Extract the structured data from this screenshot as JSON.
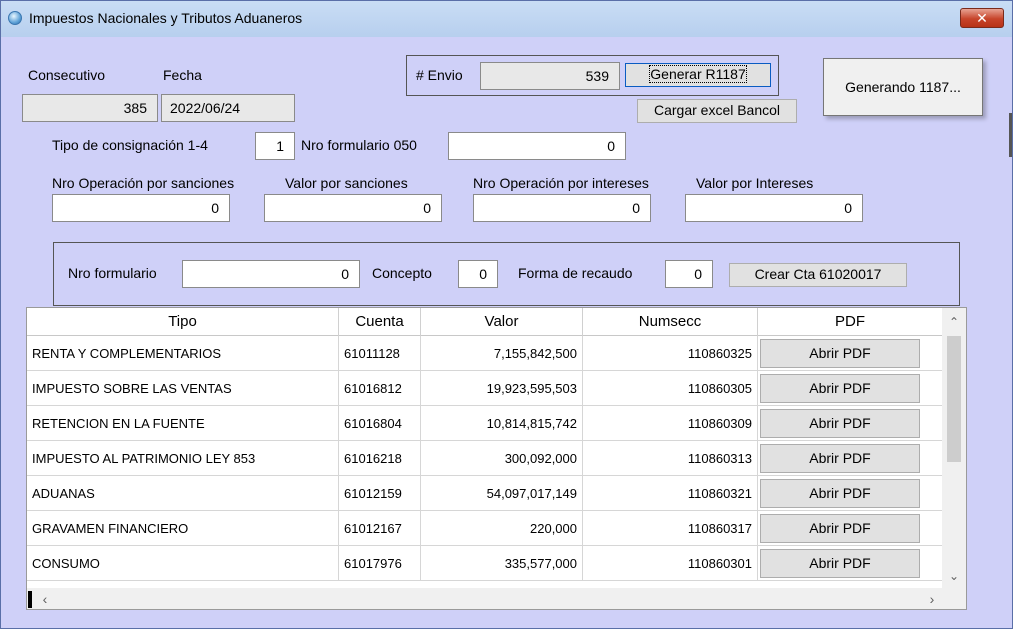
{
  "window": {
    "title": "Impuestos Nacionales y Tributos Aduaneros",
    "close_symbol": "✕"
  },
  "header": {
    "consecutivo_label": "Consecutivo",
    "consecutivo_value": "385",
    "fecha_label": "Fecha",
    "fecha_value": "2022/06/24"
  },
  "envio": {
    "label": "# Envio",
    "value": "539",
    "generar_button": "Generar R1187",
    "cargar_button": "Cargar excel Bancol"
  },
  "popup": {
    "text": "Generando 1187..."
  },
  "form": {
    "tipo_consignacion_label": "Tipo de consignación 1-4",
    "tipo_consignacion_value": "1",
    "nro_formulario_050_label": "Nro formulario 050",
    "nro_formulario_050_value": "0",
    "nro_op_sanciones_label": "Nro Operación por sanciones",
    "nro_op_sanciones_value": "0",
    "valor_sanciones_label": "Valor por sanciones",
    "valor_sanciones_value": "0",
    "nro_op_intereses_label": "Nro Operación por intereses",
    "nro_op_intereses_value": "0",
    "valor_intereses_label": "Valor por Intereses",
    "valor_intereses_value": "0"
  },
  "frame": {
    "nro_formulario_label": "Nro formulario",
    "nro_formulario_value": "0",
    "concepto_label": "Concepto",
    "concepto_value": "0",
    "forma_recaudo_label": "Forma de recaudo",
    "forma_recaudo_value": "0",
    "crear_button": "Crear Cta 61020017"
  },
  "grid": {
    "columns": [
      "Tipo",
      "Cuenta",
      "Valor",
      "Numsecc",
      "PDF"
    ],
    "rows": [
      {
        "tipo": "RENTA Y COMPLEMENTARIOS",
        "cuenta": "61011128",
        "valor": "7,155,842,500",
        "numsecc": "110860325",
        "pdf": "Abrir PDF"
      },
      {
        "tipo": "IMPUESTO SOBRE LAS VENTAS",
        "cuenta": "61016812",
        "valor": "19,923,595,503",
        "numsecc": "110860305",
        "pdf": "Abrir PDF"
      },
      {
        "tipo": "RETENCION EN LA FUENTE",
        "cuenta": "61016804",
        "valor": "10,814,815,742",
        "numsecc": "110860309",
        "pdf": "Abrir PDF"
      },
      {
        "tipo": "IMPUESTO AL PATRIMONIO LEY 853",
        "cuenta": "61016218",
        "valor": "300,092,000",
        "numsecc": "110860313",
        "pdf": "Abrir PDF"
      },
      {
        "tipo": "ADUANAS",
        "cuenta": "61012159",
        "valor": "54,097,017,149",
        "numsecc": "110860321",
        "pdf": "Abrir PDF"
      },
      {
        "tipo": "GRAVAMEN FINANCIERO",
        "cuenta": "61012167",
        "valor": "220,000",
        "numsecc": "110860317",
        "pdf": "Abrir PDF"
      },
      {
        "tipo": "CONSUMO",
        "cuenta": "61017976",
        "valor": "335,577,000",
        "numsecc": "110860301",
        "pdf": "Abrir PDF"
      }
    ]
  },
  "colors": {
    "window_bg": "#cfd0f8",
    "titlebar": "#b7cfee",
    "close_button": "#c7442a"
  }
}
